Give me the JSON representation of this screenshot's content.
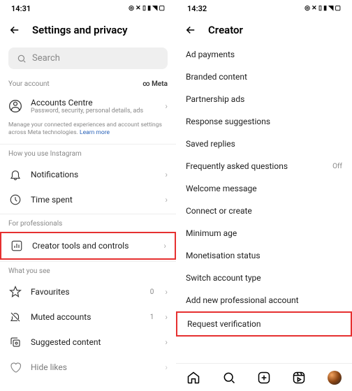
{
  "left": {
    "time": "14:31",
    "title": "Settings and privacy",
    "search_placeholder": "Search",
    "section_your_account": "Your account",
    "meta_label": "Meta",
    "accounts_centre": {
      "title": "Accounts Centre",
      "sub": "Password, security, personal details, ads"
    },
    "fine_print_before": "Manage your connected experiences and account settings across Meta technologies. ",
    "fine_print_link": "Learn more",
    "section_how_you_use": "How you use Instagram",
    "notifications": "Notifications",
    "time_spent": "Time spent",
    "section_for_pro": "For professionals",
    "creator_tools": "Creator tools and controls",
    "section_what_you_see": "What you see",
    "favourites": "Favourites",
    "favourites_count": "0",
    "muted_accounts": "Muted accounts",
    "muted_count": "1",
    "suggested_content": "Suggested content",
    "hide_likes": "Hide likes"
  },
  "right": {
    "time": "14:32",
    "title": "Creator",
    "items": [
      {
        "label": "Ad payments"
      },
      {
        "label": "Branded content"
      },
      {
        "label": "Partnership ads"
      },
      {
        "label": "Response suggestions"
      },
      {
        "label": "Saved replies"
      },
      {
        "label": "Frequently asked questions",
        "trail": "Off"
      },
      {
        "label": "Welcome message"
      },
      {
        "label": "Connect or create"
      },
      {
        "label": "Minimum age"
      },
      {
        "label": "Monetisation status"
      },
      {
        "label": "Switch account type"
      },
      {
        "label": "Add new professional account"
      },
      {
        "label": "Request verification",
        "highlight": true
      }
    ]
  }
}
